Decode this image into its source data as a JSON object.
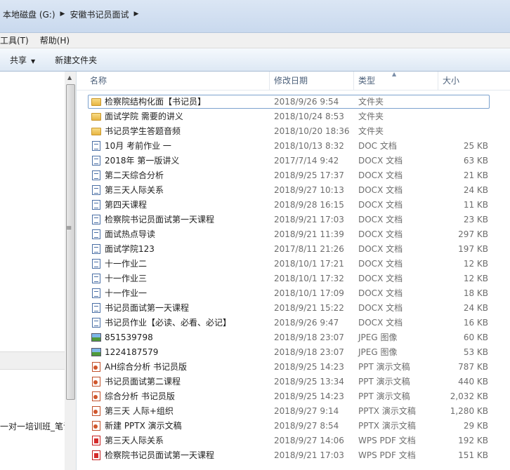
{
  "address": {
    "crumbs": [
      "本地磁盘 (G:)",
      "安徽书记员面试"
    ]
  },
  "menu": [
    "工具(T)",
    "帮助(H)"
  ],
  "toolbar": {
    "share_label": "共享",
    "newfolder_label": "新建文件夹"
  },
  "nav": {
    "item_text": "一对一培训班_笔试"
  },
  "columns": {
    "name": "名称",
    "date": "修改日期",
    "type": "类型",
    "size": "大小"
  },
  "files": [
    {
      "name": "检察院结构化面【书记员】",
      "date": "2018/9/26 9:54",
      "type": "文件夹",
      "size": "",
      "icon": "folder-icon",
      "selected": true
    },
    {
      "name": "面试学院 需要的讲义",
      "date": "2018/10/24 8:53",
      "type": "文件夹",
      "size": "",
      "icon": "folder-icon"
    },
    {
      "name": "书记员学生答题音频",
      "date": "2018/10/20 18:36",
      "type": "文件夹",
      "size": "",
      "icon": "folder-icon"
    },
    {
      "name": "10月 考前作业 一",
      "date": "2018/10/13 8:32",
      "type": "DOC 文档",
      "size": "25 KB",
      "icon": "word-doc-icon"
    },
    {
      "name": "2018年 第一版讲义",
      "date": "2017/7/14 9:42",
      "type": "DOCX 文档",
      "size": "63 KB",
      "icon": "word-doc-icon"
    },
    {
      "name": "第二天综合分析",
      "date": "2018/9/25 17:37",
      "type": "DOCX 文档",
      "size": "21 KB",
      "icon": "word-doc-icon"
    },
    {
      "name": "第三天人际关系",
      "date": "2018/9/27 10:13",
      "type": "DOCX 文档",
      "size": "24 KB",
      "icon": "word-doc-icon"
    },
    {
      "name": "第四天课程",
      "date": "2018/9/28 16:15",
      "type": "DOCX 文档",
      "size": "11 KB",
      "icon": "word-doc-icon"
    },
    {
      "name": "检察院书记员面试第一天课程",
      "date": "2018/9/21 17:03",
      "type": "DOCX 文档",
      "size": "23 KB",
      "icon": "word-doc-icon"
    },
    {
      "name": "面试热点导读",
      "date": "2018/9/21 11:39",
      "type": "DOCX 文档",
      "size": "297 KB",
      "icon": "word-doc-icon"
    },
    {
      "name": "面试学院123",
      "date": "2017/8/11 21:26",
      "type": "DOCX 文档",
      "size": "197 KB",
      "icon": "word-doc-icon"
    },
    {
      "name": "十一作业二",
      "date": "2018/10/1 17:21",
      "type": "DOCX 文档",
      "size": "12 KB",
      "icon": "word-doc-icon"
    },
    {
      "name": "十一作业三",
      "date": "2018/10/1 17:32",
      "type": "DOCX 文档",
      "size": "12 KB",
      "icon": "word-doc-icon"
    },
    {
      "name": "十一作业一",
      "date": "2018/10/1 17:09",
      "type": "DOCX 文档",
      "size": "18 KB",
      "icon": "word-doc-icon"
    },
    {
      "name": "书记员面试第一天课程",
      "date": "2018/9/21 15:22",
      "type": "DOCX 文档",
      "size": "24 KB",
      "icon": "word-doc-icon"
    },
    {
      "name": "书记员作业【必读、必看、必记】",
      "date": "2018/9/26 9:47",
      "type": "DOCX 文档",
      "size": "16 KB",
      "icon": "word-doc-icon"
    },
    {
      "name": "851539798",
      "date": "2018/9/18 23:07",
      "type": "JPEG 图像",
      "size": "60 KB",
      "icon": "image-icon"
    },
    {
      "name": "1224187579",
      "date": "2018/9/18 23:07",
      "type": "JPEG 图像",
      "size": "53 KB",
      "icon": "image-icon"
    },
    {
      "name": "AH综合分析 书记员版",
      "date": "2018/9/25 14:23",
      "type": "PPT 演示文稿",
      "size": "787 KB",
      "icon": "ppt-icon"
    },
    {
      "name": "书记员面试第二课程",
      "date": "2018/9/25 13:34",
      "type": "PPT 演示文稿",
      "size": "440 KB",
      "icon": "ppt-icon"
    },
    {
      "name": "综合分析 书记员版",
      "date": "2018/9/25 14:23",
      "type": "PPT 演示文稿",
      "size": "2,032 KB",
      "icon": "ppt-icon"
    },
    {
      "name": "第三天 人际+组织",
      "date": "2018/9/27 9:14",
      "type": "PPTX 演示文稿",
      "size": "1,280 KB",
      "icon": "ppt-icon"
    },
    {
      "name": "新建 PPTX 演示文稿",
      "date": "2018/9/27 8:54",
      "type": "PPTX 演示文稿",
      "size": "29 KB",
      "icon": "ppt-icon"
    },
    {
      "name": "第三天人际关系",
      "date": "2018/9/27 14:06",
      "type": "WPS PDF 文档",
      "size": "192 KB",
      "icon": "pdf-icon"
    },
    {
      "name": "检察院书记员面试第一天课程",
      "date": "2018/9/21 17:03",
      "type": "WPS PDF 文档",
      "size": "151 KB",
      "icon": "pdf-icon"
    }
  ]
}
